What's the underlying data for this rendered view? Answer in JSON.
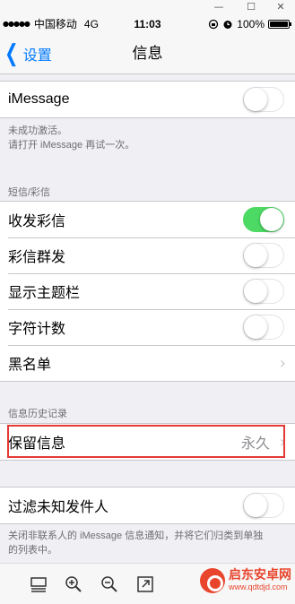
{
  "window_controls": {
    "minimize": "—",
    "maximize": "☐",
    "close": "✕"
  },
  "status_bar": {
    "signal": "●●●●●",
    "carrier": "中国移动",
    "network": "4G",
    "time": "11:03",
    "battery_percent": "100%",
    "battery_level": 1.0
  },
  "nav": {
    "back_label": "设置",
    "title": "信息"
  },
  "imessage": {
    "label": "iMessage",
    "enabled": false,
    "note_line1": "未成功激活。",
    "note_line2": "请打开 iMessage 再试一次。"
  },
  "sms_section": {
    "header": "短信/彩信",
    "rows": [
      {
        "label": "收发彩信",
        "enabled": true
      },
      {
        "label": "彩信群发",
        "enabled": false
      },
      {
        "label": "显示主题栏",
        "enabled": false
      },
      {
        "label": "字符计数",
        "enabled": false
      }
    ],
    "blacklist_label": "黑名单"
  },
  "history_section": {
    "header": "信息历史记录",
    "keep_messages_label": "保留信息",
    "keep_messages_value": "永久"
  },
  "filter": {
    "label": "过滤未知发件人",
    "enabled": false,
    "note_line1": "关闭非联系人的 iMessage 信息通知，并将它们归类到单独",
    "note_line2": "的列表中。"
  },
  "watermark": {
    "name": "启东安卓网",
    "url": "www.qdtdjd.com"
  },
  "colors": {
    "accent": "#007aff",
    "toggle_on": "#4cd964",
    "highlight": "#e53935"
  }
}
